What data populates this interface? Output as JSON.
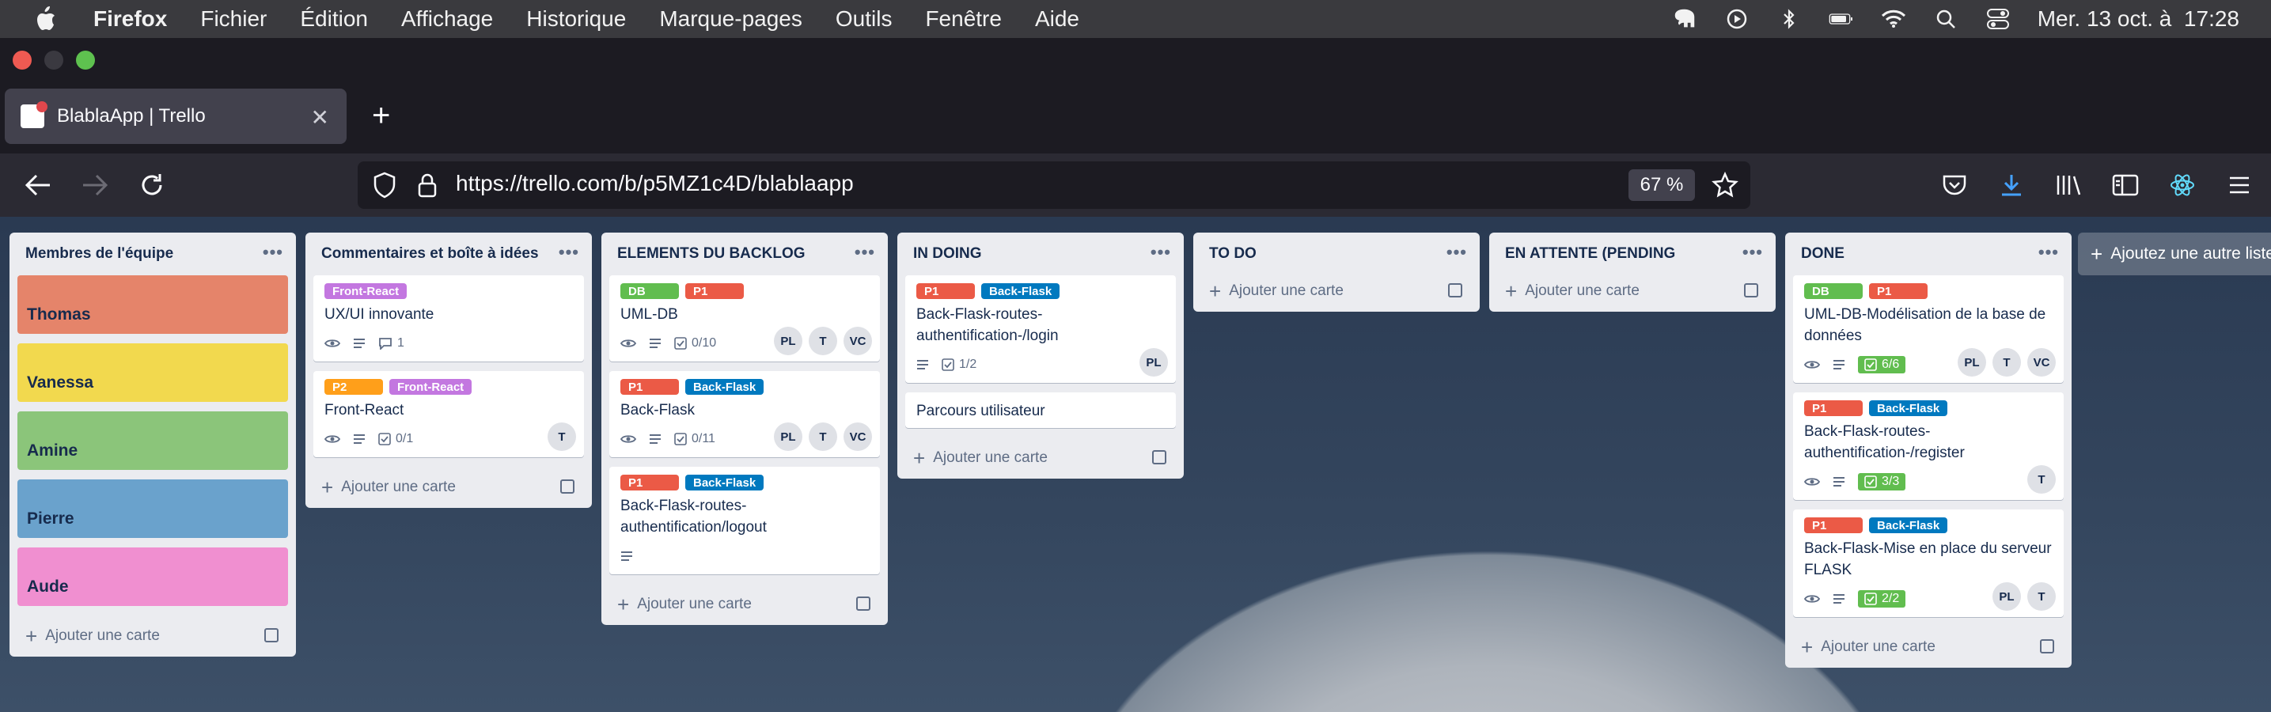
{
  "menubar": {
    "items": [
      "Firefox",
      "Fichier",
      "Édition",
      "Affichage",
      "Historique",
      "Marque-pages",
      "Outils",
      "Fenêtre",
      "Aide"
    ],
    "datetime": "Mer. 13 oct. à  17:28"
  },
  "browser": {
    "tab_title": "BlablaApp | Trello",
    "url": "https://trello.com/b/p5MZ1c4D/blablaapp",
    "zoom": "67 %"
  },
  "colors": {
    "green": "#61bd4f",
    "red": "#eb5a46",
    "blue": "#0079bf",
    "purple": "#c377e0",
    "orange": "#ff9f1a"
  },
  "board": {
    "add_card_label": "Ajouter une carte",
    "add_list_label": "Ajoutez une autre liste",
    "lists": [
      {
        "title": "Membres de l'équipe",
        "members": [
          {
            "name": "Thomas",
            "color": "#e5846a"
          },
          {
            "name": "Vanessa",
            "color": "#f2d94e"
          },
          {
            "name": "Amine",
            "color": "#8bc57a"
          },
          {
            "name": "Pierre",
            "color": "#6aa2cc"
          },
          {
            "name": "Aude",
            "color": "#f08fd0"
          }
        ]
      },
      {
        "title": "Commentaires et boîte à idées",
        "cards": [
          {
            "labels": [
              {
                "text": "Front-React",
                "color": "purple"
              }
            ],
            "title": "UX/UI innovante",
            "badges": {
              "watch": true,
              "desc": true,
              "comments": "1"
            },
            "members": []
          },
          {
            "labels": [
              {
                "text": "P2",
                "color": "orange"
              },
              {
                "text": "Front-React",
                "color": "purple"
              }
            ],
            "title": "Front-React",
            "badges": {
              "watch": true,
              "desc": true,
              "checklist": "0/1"
            },
            "members": [
              "T"
            ]
          }
        ]
      },
      {
        "title": "ELEMENTS DU BACKLOG",
        "cards": [
          {
            "labels": [
              {
                "text": "DB",
                "color": "green"
              },
              {
                "text": "P1",
                "color": "red"
              }
            ],
            "title": "UML-DB",
            "badges": {
              "watch": true,
              "desc": true,
              "checklist": "0/10"
            },
            "members": [
              "PL",
              "T",
              "VC"
            ]
          },
          {
            "labels": [
              {
                "text": "P1",
                "color": "red"
              },
              {
                "text": "Back-Flask",
                "color": "blue"
              }
            ],
            "title": "Back-Flask",
            "badges": {
              "watch": true,
              "desc": true,
              "checklist": "0/11"
            },
            "members": [
              "PL",
              "T",
              "VC"
            ]
          },
          {
            "labels": [
              {
                "text": "P1",
                "color": "red"
              },
              {
                "text": "Back-Flask",
                "color": "blue"
              }
            ],
            "title": "Back-Flask-routes-authentification/logout",
            "badges": {
              "desc": true
            },
            "members": []
          }
        ]
      },
      {
        "title": "IN DOING",
        "cards": [
          {
            "labels": [
              {
                "text": "P1",
                "color": "red"
              },
              {
                "text": "Back-Flask",
                "color": "blue"
              }
            ],
            "title": "Back-Flask-routes-authentification-/login",
            "badges": {
              "desc": true,
              "checklist": "1/2"
            },
            "members": [
              "PL"
            ]
          },
          {
            "labels": [],
            "title": "Parcours utilisateur",
            "badges": {},
            "members": []
          }
        ]
      },
      {
        "title": "TO DO",
        "cards": []
      },
      {
        "title": "EN ATTENTE (PENDING",
        "cards": []
      },
      {
        "title": "DONE",
        "cards": [
          {
            "labels": [
              {
                "text": "DB",
                "color": "green"
              },
              {
                "text": "P1",
                "color": "red"
              }
            ],
            "title": "UML-DB-Modélisation de la base de données",
            "badges": {
              "watch": true,
              "desc": true,
              "checklist_done": "6/6"
            },
            "members": [
              "PL",
              "T",
              "VC"
            ]
          },
          {
            "labels": [
              {
                "text": "P1",
                "color": "red"
              },
              {
                "text": "Back-Flask",
                "color": "blue"
              }
            ],
            "title": "Back-Flask-routes-authentification-/register",
            "badges": {
              "watch": true,
              "desc": true,
              "checklist_done": "3/3"
            },
            "members": [
              "T"
            ]
          },
          {
            "labels": [
              {
                "text": "P1",
                "color": "red"
              },
              {
                "text": "Back-Flask",
                "color": "blue"
              }
            ],
            "title": "Back-Flask-Mise en place du serveur FLASK",
            "badges": {
              "watch": true,
              "desc": true,
              "checklist_done": "2/2"
            },
            "members": [
              "PL",
              "T"
            ]
          }
        ]
      }
    ]
  }
}
